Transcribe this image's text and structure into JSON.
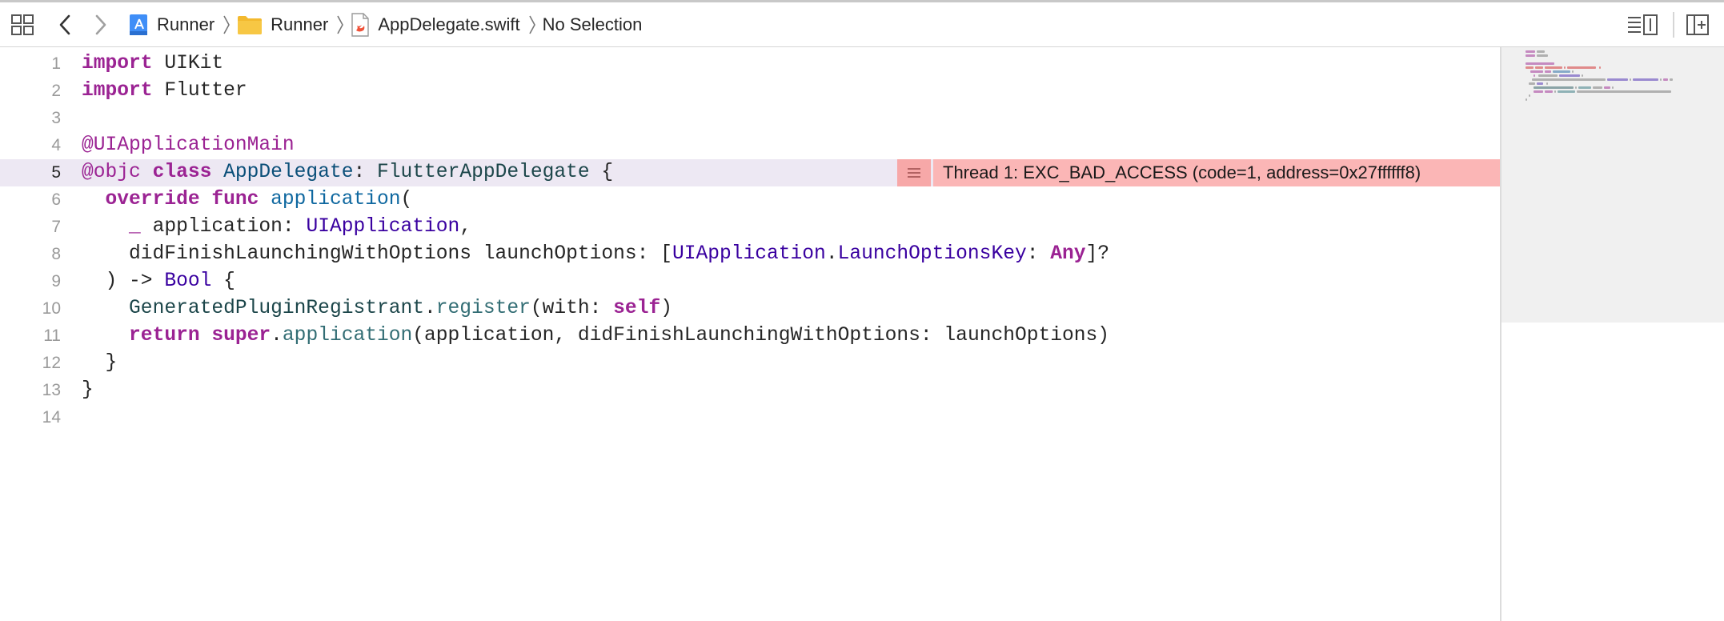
{
  "toolbar": {
    "icons": {
      "related": "grid-icon",
      "back": "chevron-left-icon",
      "forward": "chevron-right-icon",
      "adjust_editor": "adjust-editor-icon",
      "add_editor": "add-editor-icon"
    }
  },
  "breadcrumb": [
    {
      "label": "Runner",
      "icon": "xcode-project-icon"
    },
    {
      "label": "Runner",
      "icon": "folder-icon"
    },
    {
      "label": "AppDelegate.swift",
      "icon": "swift-file-icon"
    },
    {
      "label": "No Selection",
      "icon": ""
    }
  ],
  "editor": {
    "current_line": "5",
    "lines": [
      {
        "n": "1",
        "tokens": [
          [
            "kw",
            "import"
          ],
          [
            "",
            "UIKit"
          ]
        ]
      },
      {
        "n": "2",
        "tokens": [
          [
            "kw",
            "import"
          ],
          [
            "",
            "Flutter"
          ]
        ]
      },
      {
        "n": "3",
        "tokens": []
      },
      {
        "n": "4",
        "tokens": [
          [
            "at",
            "@UIApplicationMain"
          ]
        ]
      },
      {
        "n": "5",
        "tokens": [
          [
            "at",
            "@objc"
          ],
          [
            "kw",
            "class"
          ],
          [
            "cls-d",
            "AppDelegate"
          ],
          [
            "",
            ": "
          ],
          [
            "cls",
            "FlutterAppDelegate"
          ],
          [
            "",
            " {"
          ]
        ]
      },
      {
        "n": "6",
        "tokens": [
          [
            "",
            "  "
          ],
          [
            "kw",
            "override"
          ],
          [
            "kw",
            "func"
          ],
          [
            "fn",
            "application"
          ],
          [
            "",
            "("
          ]
        ]
      },
      {
        "n": "7",
        "tokens": [
          [
            "",
            "    "
          ],
          [
            "kw",
            "_"
          ],
          [
            "",
            " application: "
          ],
          [
            "typ",
            "UIApplication"
          ],
          [
            "",
            ","
          ]
        ]
      },
      {
        "n": "8",
        "tokens": [
          [
            "",
            "    didFinishLaunchingWithOptions launchOptions: ["
          ],
          [
            "typ",
            "UIApplication"
          ],
          [
            "",
            "."
          ],
          [
            "typ",
            "LaunchOptionsKey"
          ],
          [
            "",
            ": "
          ],
          [
            "kw",
            "Any"
          ],
          [
            "",
            "]?"
          ]
        ]
      },
      {
        "n": "9",
        "tokens": [
          [
            "",
            "  ) -> "
          ],
          [
            "typ",
            "Bool"
          ],
          [
            "",
            " {"
          ]
        ]
      },
      {
        "n": "10",
        "tokens": [
          [
            "",
            "    "
          ],
          [
            "cls",
            "GeneratedPluginRegistrant"
          ],
          [
            "",
            "."
          ],
          [
            "mth",
            "register"
          ],
          [
            "",
            "(with: "
          ],
          [
            "kw",
            "self"
          ],
          [
            "",
            ")"
          ]
        ]
      },
      {
        "n": "11",
        "tokens": [
          [
            "",
            "    "
          ],
          [
            "kw",
            "return"
          ],
          [
            "kw",
            "super"
          ],
          [
            "",
            "."
          ],
          [
            "mth",
            "application"
          ],
          [
            "",
            "(application, didFinishLaunchingWithOptions: launchOptions)"
          ]
        ]
      },
      {
        "n": "12",
        "tokens": [
          [
            "",
            "  }"
          ]
        ]
      },
      {
        "n": "13",
        "tokens": [
          [
            "",
            "}"
          ]
        ]
      },
      {
        "n": "14",
        "tokens": []
      }
    ]
  },
  "error": {
    "message": "Thread 1: EXC_BAD_ACCESS (code=1, address=0x27ffffff8)",
    "line": "5",
    "icon": "list-icon",
    "color": "#fbb6b6"
  },
  "minimap": {
    "icon": "minimap"
  }
}
